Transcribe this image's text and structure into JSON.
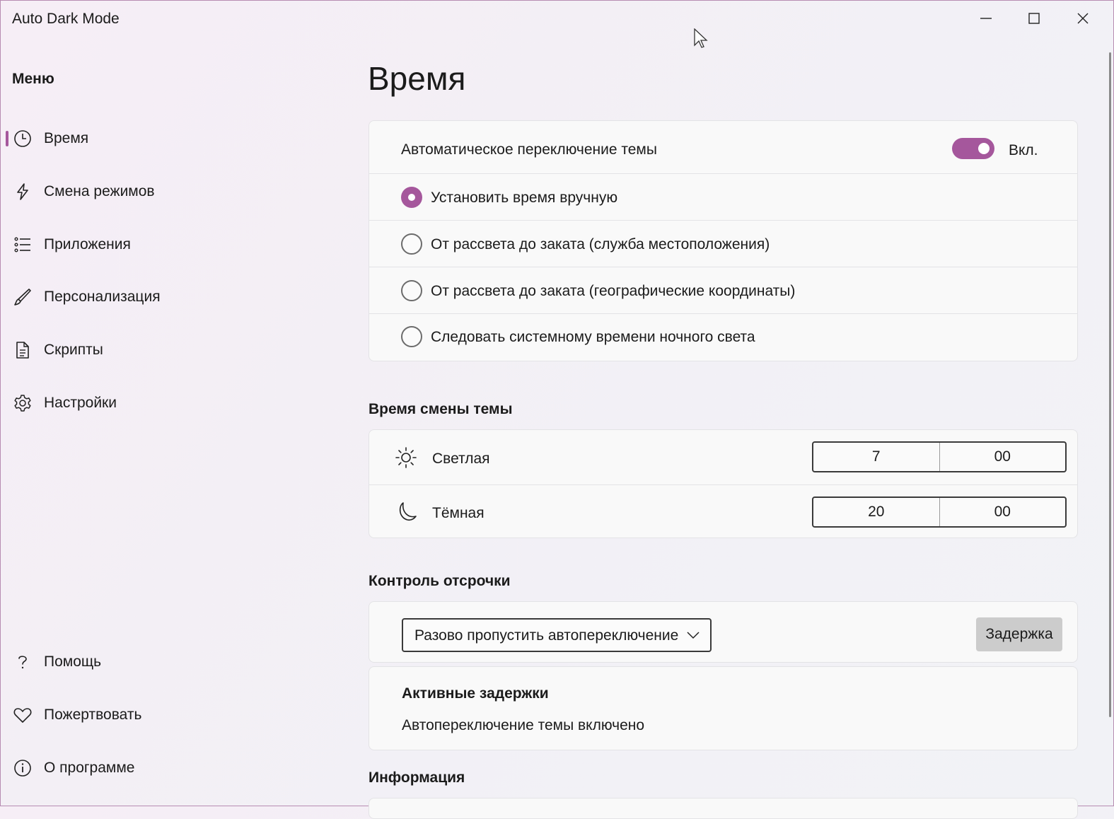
{
  "window": {
    "title": "Auto Dark Mode",
    "controls": [
      "minimize-icon",
      "maximize-icon",
      "close-icon"
    ]
  },
  "theme": {
    "accent": "#a5579c",
    "border": "#b78cb2"
  },
  "sidebar": {
    "title": "Меню",
    "items": [
      {
        "label": "Время",
        "icon": "clock-icon",
        "selected": true
      },
      {
        "label": "Смена режимов",
        "icon": "lightning-icon",
        "selected": false
      },
      {
        "label": "Приложения",
        "icon": "list-icon",
        "selected": false
      },
      {
        "label": "Персонализация",
        "icon": "brush-icon",
        "selected": false
      },
      {
        "label": "Скрипты",
        "icon": "document-icon",
        "selected": false
      },
      {
        "label": "Настройки",
        "icon": "gear-icon",
        "selected": false
      }
    ],
    "footer_items": [
      {
        "label": "Помощь",
        "icon": "question-icon"
      },
      {
        "label": "Пожертвовать",
        "icon": "heart-icon"
      },
      {
        "label": "О программе",
        "icon": "info-icon"
      }
    ]
  },
  "main": {
    "page_title": "Время",
    "auto_switch": {
      "label": "Автоматическое переключение темы",
      "toggle_state": "Вкл.",
      "enabled": true
    },
    "modes": [
      {
        "label": "Установить время вручную",
        "checked": true
      },
      {
        "label": "От рассвета до заката (служба местоположения)",
        "checked": false
      },
      {
        "label": "От рассвета до заката (географические координаты)",
        "checked": false
      },
      {
        "label": "Следовать системному времени ночного света",
        "checked": false
      }
    ],
    "switch_time": {
      "title": "Время смены темы",
      "light": {
        "label": "Светлая",
        "icon": "sun-icon",
        "hour": "7",
        "minute": "00"
      },
      "dark": {
        "label": "Тёмная",
        "icon": "moon-icon",
        "hour": "20",
        "minute": "00"
      }
    },
    "postpone": {
      "title": "Контроль отсрочки",
      "dropdown_value": "Разово пропустить автопереключение",
      "button_label": "Задержка",
      "active_title": "Активные задержки",
      "active_status": "Автопереключение темы включено"
    },
    "info_title": "Информация"
  }
}
